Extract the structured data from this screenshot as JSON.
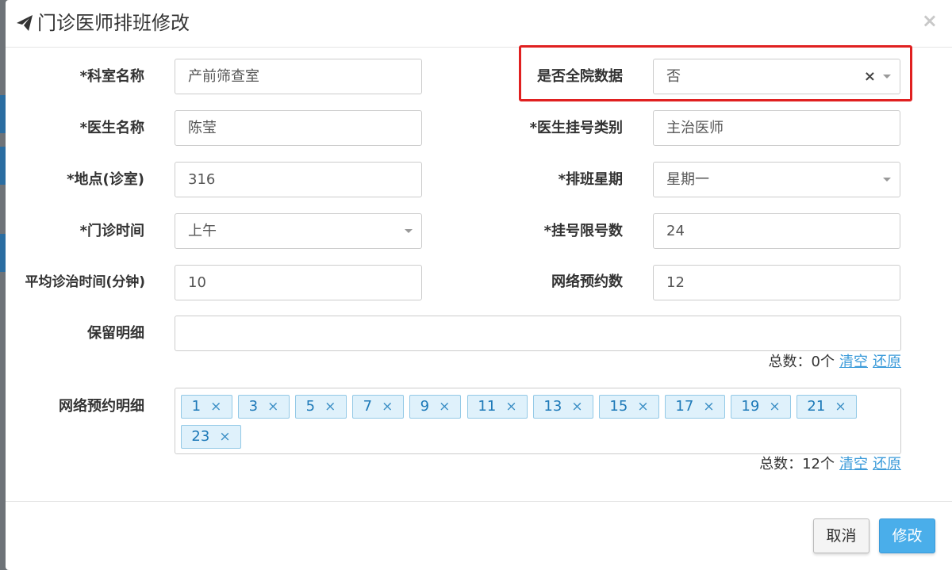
{
  "modal": {
    "title": "门诊医师排班修改",
    "close": "×"
  },
  "form": {
    "dept_label": "*科室名称",
    "dept_value": "产前筛查室",
    "all_hospital_label": "是否全院数据",
    "all_hospital_value": "否",
    "all_hospital_clear": "×",
    "doctor_label": "*医生名称",
    "doctor_value": "陈莹",
    "reg_type_label": "*医生挂号类别",
    "reg_type_value": "主治医师",
    "location_label": "*地点(诊室)",
    "location_value": "316",
    "weekday_label": "*排班星期",
    "weekday_value": "星期一",
    "clinic_time_label": "*门诊时间",
    "clinic_time_value": "上午",
    "reg_limit_label": "*挂号限号数",
    "reg_limit_value": "24",
    "avg_time_label": "平均诊治时间(分钟)",
    "avg_time_value": "10",
    "online_count_label": "网络预约数",
    "online_count_value": "12",
    "reserve_detail_label": "保留明细",
    "reserve_detail_value": "",
    "reserve_total": "总数：0个",
    "online_detail_label": "网络预约明细",
    "online_total": "总数：12个",
    "clear_link": "清空",
    "restore_link": "还原",
    "tags": [
      "1",
      "3",
      "5",
      "7",
      "9",
      "11",
      "13",
      "15",
      "17",
      "19",
      "21",
      "23"
    ],
    "tag_remove": "×"
  },
  "footer": {
    "cancel_label": "取消",
    "submit_label": "修改"
  },
  "colors": {
    "highlight": "#e02020",
    "primary": "#4aaeea",
    "link": "#3a9ad9",
    "tag_bg": "#dff1fb"
  }
}
